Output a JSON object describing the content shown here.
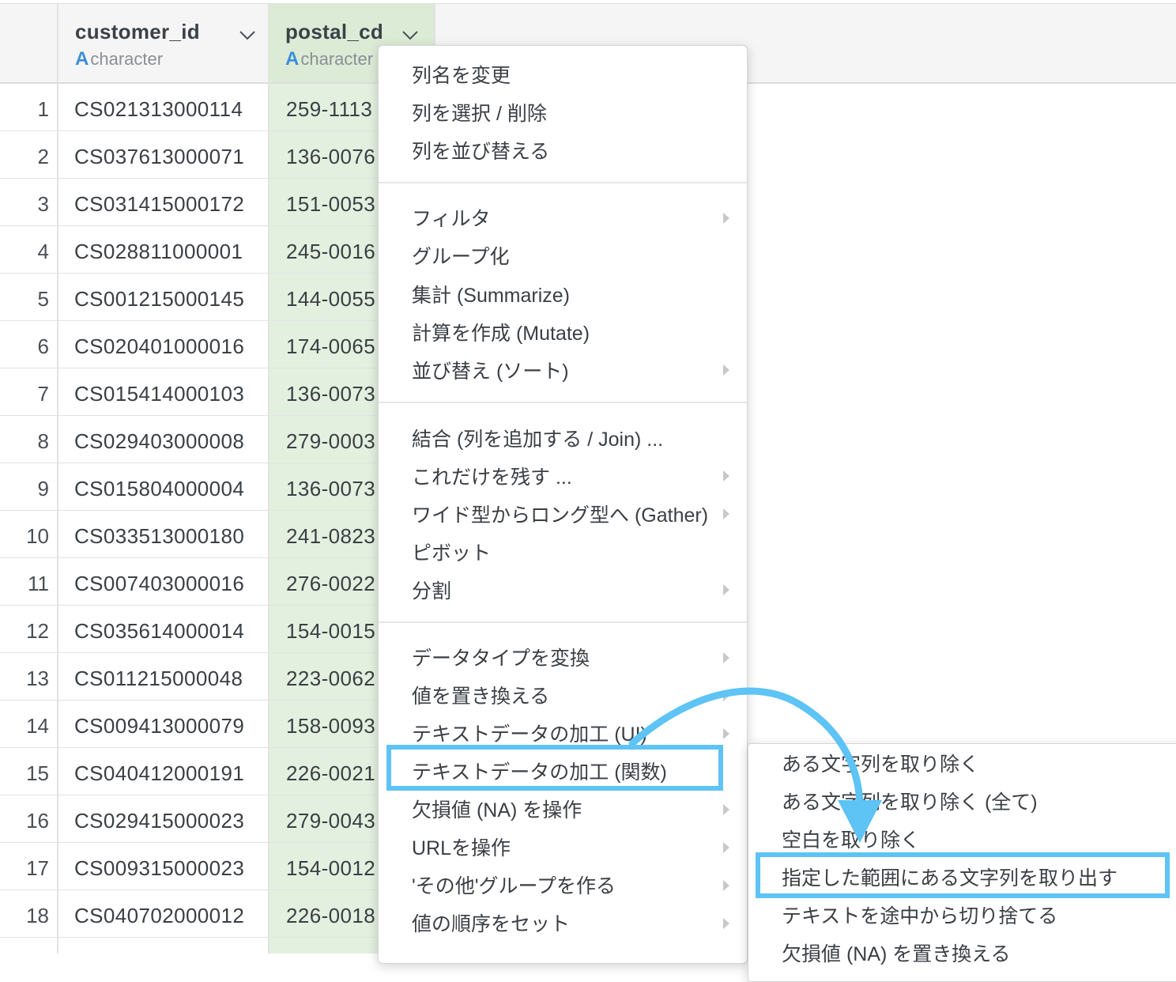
{
  "columns": [
    {
      "name": "customer_id",
      "type_icon": "A",
      "type": "character"
    },
    {
      "name": "postal_cd",
      "type_icon": "A",
      "type": "character"
    }
  ],
  "rows": [
    {
      "n": "1",
      "customer_id": "CS021313000114",
      "postal_cd": "259-1113"
    },
    {
      "n": "2",
      "customer_id": "CS037613000071",
      "postal_cd": "136-0076"
    },
    {
      "n": "3",
      "customer_id": "CS031415000172",
      "postal_cd": "151-0053"
    },
    {
      "n": "4",
      "customer_id": "CS028811000001",
      "postal_cd": "245-0016"
    },
    {
      "n": "5",
      "customer_id": "CS001215000145",
      "postal_cd": "144-0055"
    },
    {
      "n": "6",
      "customer_id": "CS020401000016",
      "postal_cd": "174-0065"
    },
    {
      "n": "7",
      "customer_id": "CS015414000103",
      "postal_cd": "136-0073"
    },
    {
      "n": "8",
      "customer_id": "CS029403000008",
      "postal_cd": "279-0003"
    },
    {
      "n": "9",
      "customer_id": "CS015804000004",
      "postal_cd": "136-0073"
    },
    {
      "n": "10",
      "customer_id": "CS033513000180",
      "postal_cd": "241-0823"
    },
    {
      "n": "11",
      "customer_id": "CS007403000016",
      "postal_cd": "276-0022"
    },
    {
      "n": "12",
      "customer_id": "CS035614000014",
      "postal_cd": "154-0015"
    },
    {
      "n": "13",
      "customer_id": "CS011215000048",
      "postal_cd": "223-0062"
    },
    {
      "n": "14",
      "customer_id": "CS009413000079",
      "postal_cd": "158-0093"
    },
    {
      "n": "15",
      "customer_id": "CS040412000191",
      "postal_cd": "226-0021"
    },
    {
      "n": "16",
      "customer_id": "CS029415000023",
      "postal_cd": "279-0043"
    },
    {
      "n": "17",
      "customer_id": "CS009315000023",
      "postal_cd": "154-0012"
    },
    {
      "n": "18",
      "customer_id": "CS040702000012",
      "postal_cd": "226-0018"
    }
  ],
  "menu": {
    "group1": [
      "列名を変更",
      "列を選択 / 削除",
      "列を並び替える"
    ],
    "group2": [
      {
        "label": "フィルタ",
        "submenu": true
      },
      {
        "label": "グループ化",
        "submenu": false
      },
      {
        "label": "集計 (Summarize)",
        "submenu": false
      },
      {
        "label": "計算を作成 (Mutate)",
        "submenu": false
      },
      {
        "label": "並び替え (ソート)",
        "submenu": true
      }
    ],
    "group3": [
      {
        "label": "結合 (列を追加する / Join) ...",
        "submenu": false
      },
      {
        "label": "これだけを残す ...",
        "submenu": true
      },
      {
        "label": "ワイド型からロング型へ (Gather)",
        "submenu": true
      },
      {
        "label": "ピボット",
        "submenu": false
      },
      {
        "label": "分割",
        "submenu": true
      }
    ],
    "group4": [
      {
        "label": "データタイプを変換",
        "submenu": true
      },
      {
        "label": "値を置き換える",
        "submenu": true
      },
      {
        "label": "テキストデータの加工 (UI)",
        "submenu": true
      },
      {
        "label": "テキストデータの加工 (関数)",
        "submenu": true
      },
      {
        "label": "欠損値 (NA) を操作",
        "submenu": true
      },
      {
        "label": "URLを操作",
        "submenu": true
      },
      {
        "label": "'その他'グループを作る",
        "submenu": true
      },
      {
        "label": "値の順序をセット",
        "submenu": true
      }
    ]
  },
  "submenu": [
    "ある文字列を取り除く",
    "ある文字列を取り除く (全て)",
    "空白を取り除く",
    "指定した範囲にある文字列を取り出す",
    "テキストを途中から切り捨てる",
    "欠損値 (NA) を置き換える"
  ],
  "colors": {
    "highlight": "#5ec3f5",
    "type_icon": "#3b8ed8",
    "selected_column_bg": "#e3f0df"
  }
}
